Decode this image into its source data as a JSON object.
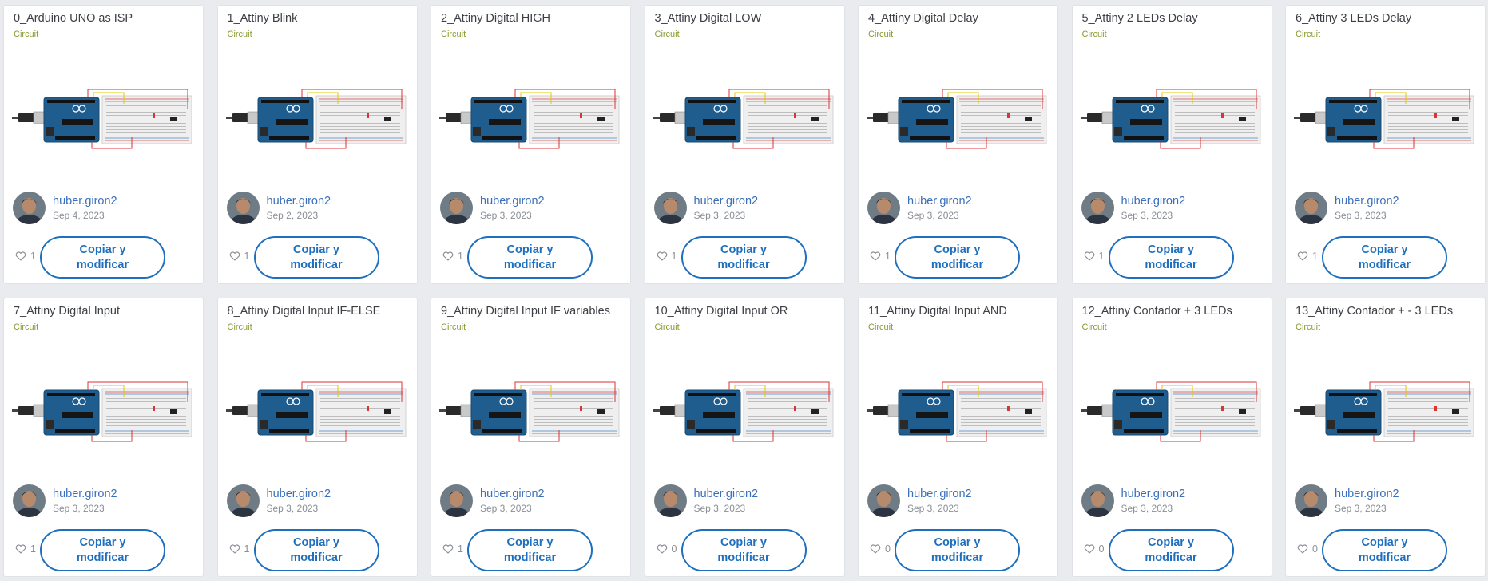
{
  "projects": [
    {
      "title": "0_Arduino UNO as ISP",
      "type": "Circuit",
      "author": "huber.giron2",
      "date": "Sep 4, 2023",
      "likes": "1",
      "action": "Copiar y\nmodificar"
    },
    {
      "title": "1_Attiny Blink",
      "type": "Circuit",
      "author": "huber.giron2",
      "date": "Sep 2, 2023",
      "likes": "1",
      "action": "Copiar y\nmodificar"
    },
    {
      "title": "2_Attiny Digital HIGH",
      "type": "Circuit",
      "author": "huber.giron2",
      "date": "Sep 3, 2023",
      "likes": "1",
      "action": "Copiar y\nmodificar"
    },
    {
      "title": "3_Attiny Digital LOW",
      "type": "Circuit",
      "author": "huber.giron2",
      "date": "Sep 3, 2023",
      "likes": "1",
      "action": "Copiar y\nmodificar"
    },
    {
      "title": "4_Attiny Digital Delay",
      "type": "Circuit",
      "author": "huber.giron2",
      "date": "Sep 3, 2023",
      "likes": "1",
      "action": "Copiar y\nmodificar"
    },
    {
      "title": "5_Attiny 2 LEDs Delay",
      "type": "Circuit",
      "author": "huber.giron2",
      "date": "Sep 3, 2023",
      "likes": "1",
      "action": "Copiar y\nmodificar"
    },
    {
      "title": "6_Attiny 3 LEDs Delay",
      "type": "Circuit",
      "author": "huber.giron2",
      "date": "Sep 3, 2023",
      "likes": "1",
      "action": "Copiar y\nmodificar"
    },
    {
      "title": "7_Attiny Digital Input",
      "type": "Circuit",
      "author": "huber.giron2",
      "date": "Sep 3, 2023",
      "likes": "1",
      "action": "Copiar y\nmodificar"
    },
    {
      "title": "8_Attiny Digital Input IF-ELSE",
      "type": "Circuit",
      "author": "huber.giron2",
      "date": "Sep 3, 2023",
      "likes": "1",
      "action": "Copiar y\nmodificar"
    },
    {
      "title": "9_Attiny Digital Input IF variables",
      "type": "Circuit",
      "author": "huber.giron2",
      "date": "Sep 3, 2023",
      "likes": "1",
      "action": "Copiar y\nmodificar"
    },
    {
      "title": "10_Attiny Digital Input OR",
      "type": "Circuit",
      "author": "huber.giron2",
      "date": "Sep 3, 2023",
      "likes": "0",
      "action": "Copiar y\nmodificar"
    },
    {
      "title": "11_Attiny Digital Input AND",
      "type": "Circuit",
      "author": "huber.giron2",
      "date": "Sep 3, 2023",
      "likes": "0",
      "action": "Copiar y\nmodificar"
    },
    {
      "title": "12_Attiny Contador + 3 LEDs",
      "type": "Circuit",
      "author": "huber.giron2",
      "date": "Sep 3, 2023",
      "likes": "0",
      "action": "Copiar y\nmodificar"
    },
    {
      "title": "13_Attiny Contador + - 3 LEDs",
      "type": "Circuit",
      "author": "huber.giron2",
      "date": "Sep 3, 2023",
      "likes": "0",
      "action": "Copiar y\nmodificar"
    }
  ],
  "colors": {
    "accent": "#1f6fbf",
    "author_link": "#3a6fbb",
    "type_label": "#8a9a2f",
    "board": "#1f5d8f",
    "breadboard": "#efefef"
  },
  "icons": {
    "thumbnail": "arduino-breadboard-circuit-thumbnail",
    "avatar": "user-avatar",
    "like": "heart-outline-icon"
  }
}
